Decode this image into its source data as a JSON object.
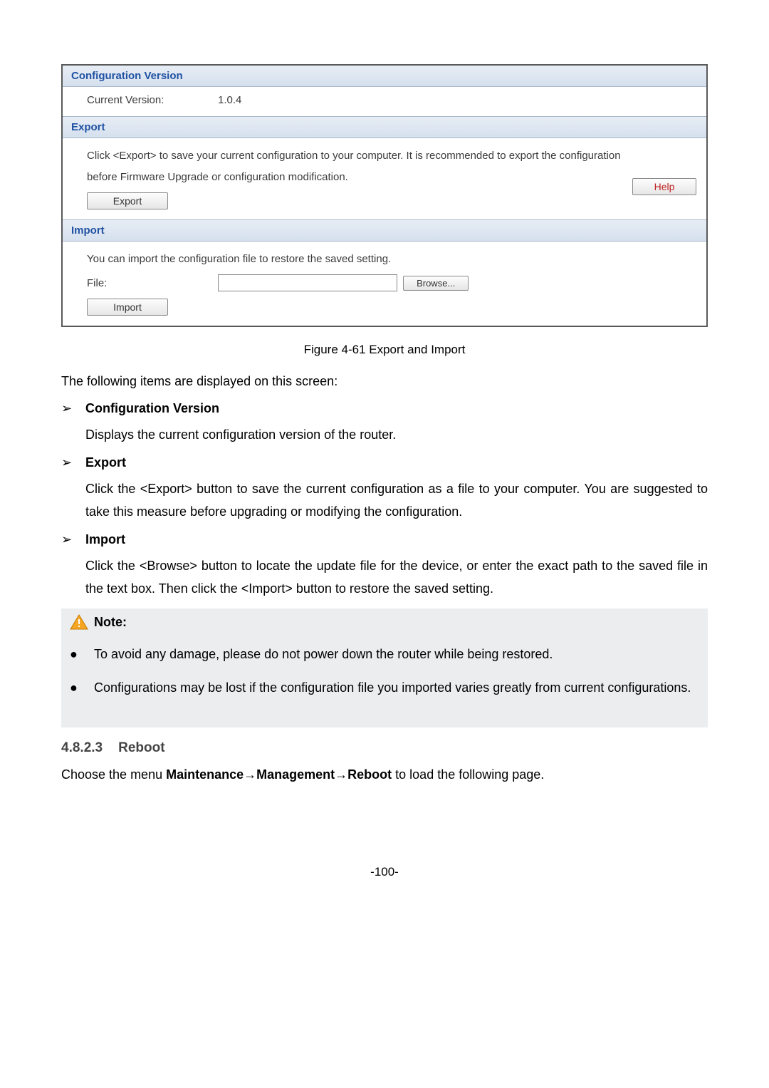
{
  "panel": {
    "configVersion": {
      "header": "Configuration Version",
      "label": "Current Version:",
      "value": "1.0.4"
    },
    "export": {
      "header": "Export",
      "desc": "Click <Export> to save your current configuration to your computer. It is recommended to export the configuration before Firmware Upgrade or configuration modification.",
      "button": "Export",
      "help": "Help"
    },
    "import": {
      "header": "Import",
      "desc": "You can import the configuration file to restore the saved setting.",
      "fileLabel": "File:",
      "browse": "Browse...",
      "button": "Import"
    }
  },
  "caption": "Figure 4-61 Export and Import",
  "intro": "The following items are displayed on this screen:",
  "items": {
    "a": {
      "head": "Configuration Version",
      "body": "Displays the current configuration version of the router."
    },
    "b": {
      "head": "Export",
      "body": "Click the <Export> button to save the current configuration as a file to your computer. You are suggested to take this measure before upgrading or modifying the configuration."
    },
    "c": {
      "head": "Import",
      "body": "Click the <Browse> button to locate the update file for the device, or enter the exact path to the saved file in the text box. Then click the <Import> button to restore the saved setting."
    }
  },
  "note": {
    "head": "Note:",
    "n1": "To avoid any damage, please do not power down the router while being restored.",
    "n2": "Configurations may be lost if the configuration file you imported varies greatly from current configurations."
  },
  "section": {
    "num": "4.8.2.3",
    "title": "Reboot",
    "body_pre": "Choose the menu ",
    "body_b1": "Maintenance",
    "body_arr": "→",
    "body_b2": "Management",
    "body_b3": "Reboot",
    "body_post": " to load the following page."
  },
  "pageNum": "-100-"
}
